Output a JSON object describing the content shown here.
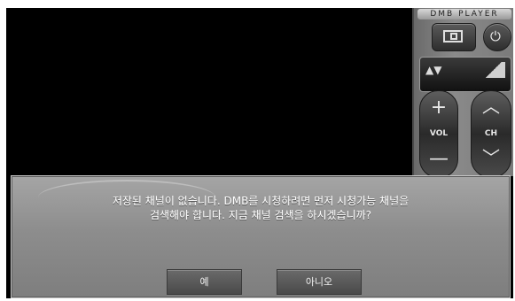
{
  "player": {
    "title": "DMB PLAYER",
    "vol_label": "VOL",
    "ch_label": "CH",
    "vol_up_glyph": "+",
    "vol_down_glyph": "—",
    "ch_up_glyph": "︿",
    "ch_down_glyph": "﹀",
    "power_glyph": "⏻",
    "channel_arrows": "▲▼"
  },
  "dialog": {
    "message_line1": "저장된 채널이 없습니다. DMB를 시청하려면 먼저 시청가능 채널을",
    "message_line2": "검색해야 합니다. 지금 채널 검색을 하시겠습니까?",
    "yes_label": "예",
    "no_label": "아니오"
  },
  "icons": {
    "screen_mode": "screen-mode-icon",
    "power": "power-icon",
    "signal": "signal-strength-icon"
  }
}
